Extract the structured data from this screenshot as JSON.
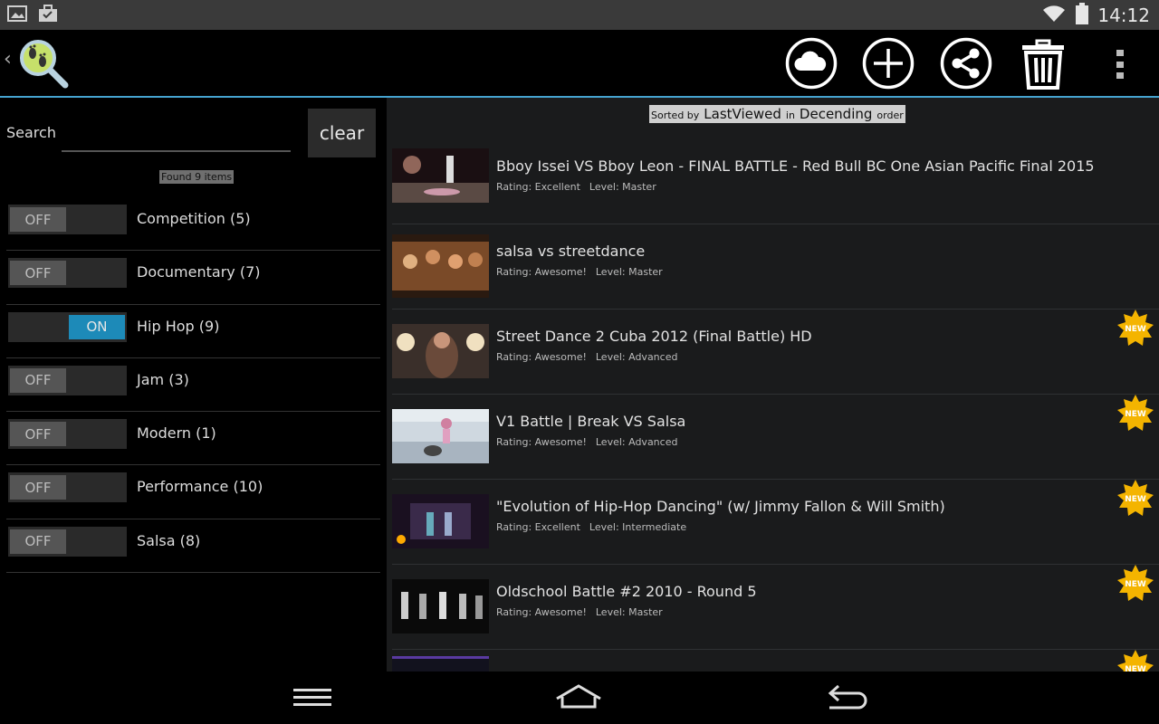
{
  "status_bar": {
    "left_icons": [
      "gallery-icon",
      "briefcase-icon"
    ],
    "right_icons": [
      "wifi-icon",
      "battery-icon"
    ],
    "time": "14:12"
  },
  "action_bar": {
    "up_glyph": "‹",
    "logo_icon": "footprints-search-icon",
    "actions": [
      "cloud-icon",
      "add-icon",
      "share-icon",
      "trash-icon",
      "overflow-menu-icon"
    ],
    "accent_color": "#45a3cf"
  },
  "search": {
    "label": "Search",
    "value": "",
    "clear_label": "clear",
    "found_text": "Found 9 items"
  },
  "categories": [
    {
      "label": "Competition (5)",
      "state": "OFF",
      "on": false
    },
    {
      "label": "Documentary (7)",
      "state": "OFF",
      "on": false
    },
    {
      "label": "Hip Hop (9)",
      "state": "ON",
      "on": true
    },
    {
      "label": "Jam (3)",
      "state": "OFF",
      "on": false
    },
    {
      "label": "Modern (1)",
      "state": "OFF",
      "on": false
    },
    {
      "label": "Performance (10)",
      "state": "OFF",
      "on": false
    },
    {
      "label": "Salsa (8)",
      "state": "OFF",
      "on": false
    }
  ],
  "sort": {
    "prefix": "Sorted by",
    "field": "LastViewed",
    "in_word": "in",
    "order": "Decending",
    "suffix": "order"
  },
  "videos": [
    {
      "title": "Bboy Issei VS Bboy Leon - FINAL BATTLE - Red Bull BC One Asian Pacific Final 2015",
      "rating": "Rating: Excellent",
      "level": "Level: Master",
      "is_new": false
    },
    {
      "title": "salsa vs streetdance",
      "rating": "Rating: Awesome!",
      "level": "Level: Master",
      "is_new": false
    },
    {
      "title": "Street Dance 2 Cuba 2012 (Final Battle) HD",
      "rating": "Rating: Awesome!",
      "level": "Level: Advanced",
      "is_new": true
    },
    {
      "title": "V1 Battle | Break VS Salsa",
      "rating": "Rating: Awesome!",
      "level": "Level: Advanced",
      "is_new": true
    },
    {
      "title": "\"Evolution of Hip-Hop Dancing\" (w/ Jimmy Fallon & Will Smith)",
      "rating": "Rating: Excellent",
      "level": "Level: Intermediate",
      "is_new": true
    },
    {
      "title": "Oldschool Battle #2 2010 - Round 5",
      "rating": "Rating: Awesome!",
      "level": "Level: Master",
      "is_new": true
    },
    {
      "title": "",
      "rating": "",
      "level": "",
      "is_new": true
    }
  ],
  "new_badge_text": "NEW",
  "nav_bar": {
    "buttons": [
      "menu-icon",
      "home-icon",
      "back-icon"
    ]
  }
}
